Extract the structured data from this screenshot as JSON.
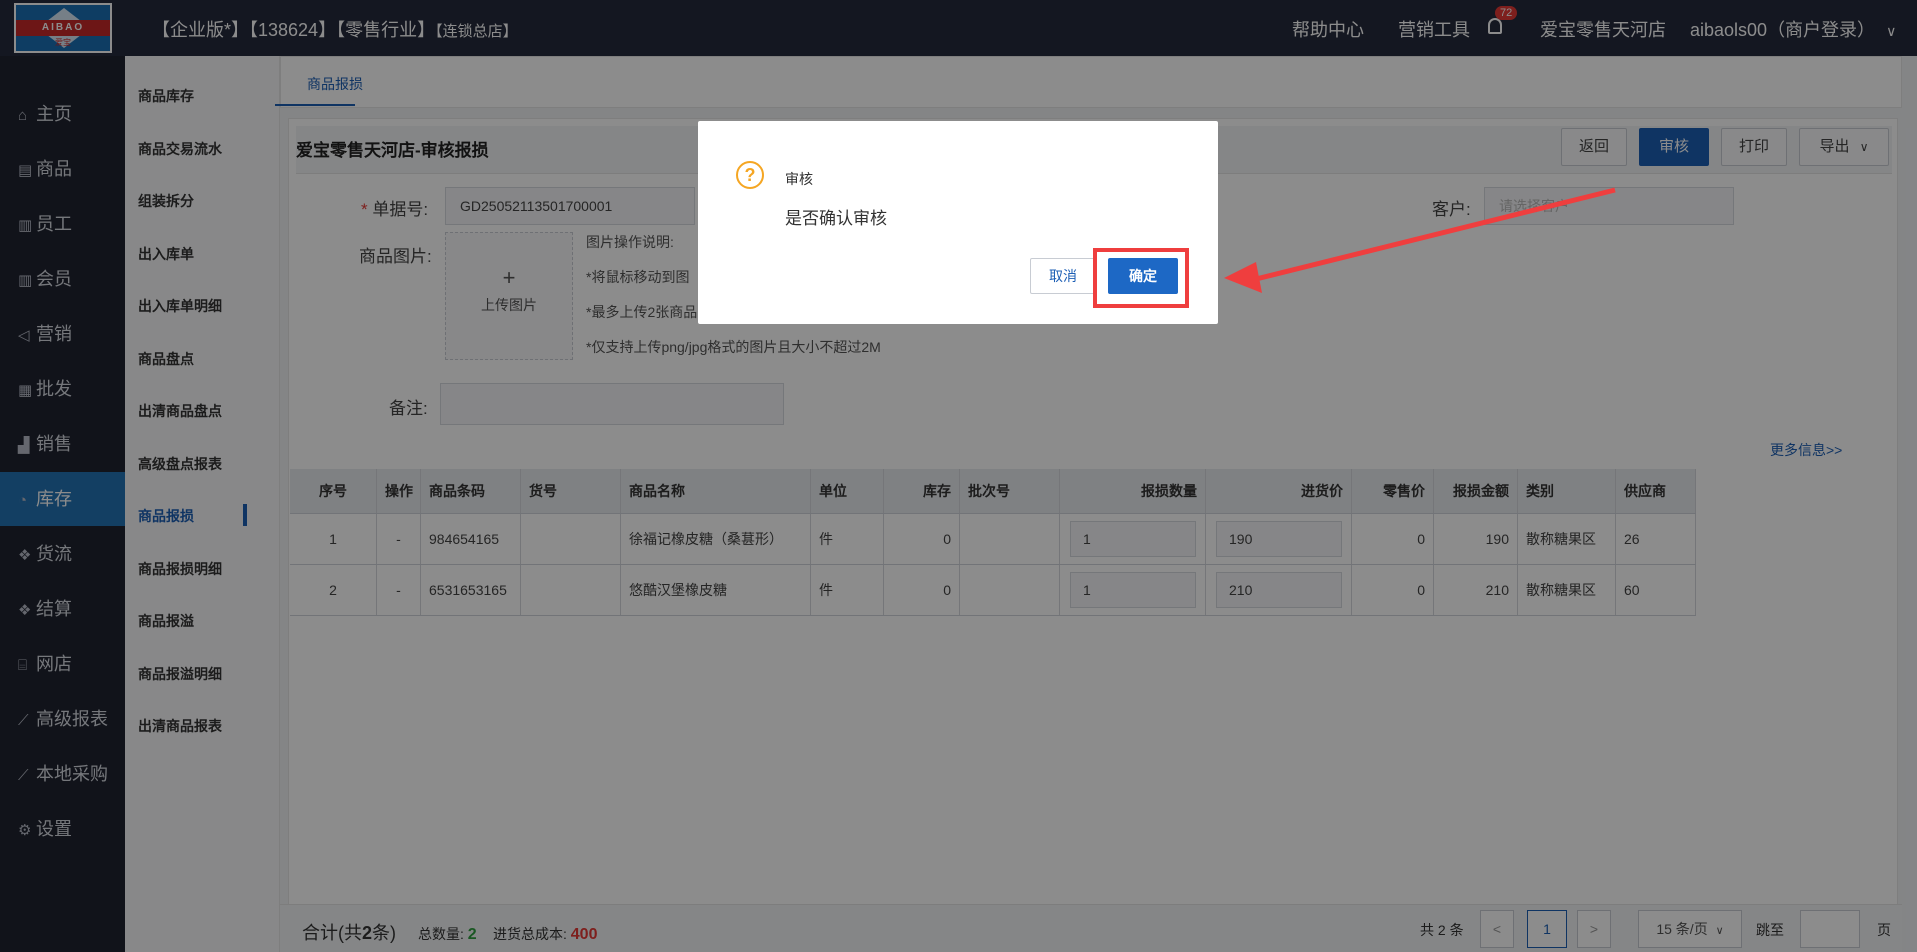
{
  "header": {
    "logo_text": "AIBAO",
    "logo_sub": "爱宝",
    "title_main": "【企业版*】【138624】【零售行业】",
    "title_small": "【连锁总店】",
    "help": "帮助中心",
    "marketing_tools": "营销工具",
    "notification_count": "72",
    "store_name": "爱宝零售天河店",
    "user": "aibaols00（商户登录）",
    "user_chevron": "∨"
  },
  "nav": {
    "items": [
      {
        "icon": "⌂",
        "label": "主页"
      },
      {
        "icon": "▤",
        "label": "商品"
      },
      {
        "icon": "▥",
        "label": "员工"
      },
      {
        "icon": "▥",
        "label": "会员"
      },
      {
        "icon": "◁",
        "label": "营销"
      },
      {
        "icon": "▦",
        "label": "批发"
      },
      {
        "icon": "▟",
        "label": "销售"
      },
      {
        "icon": "◔",
        "label": "库存"
      },
      {
        "icon": "❖",
        "label": "货流"
      },
      {
        "icon": "❖",
        "label": "结算"
      },
      {
        "icon": "⌸",
        "label": "网店"
      },
      {
        "icon": "⟋",
        "label": "高级报表"
      },
      {
        "icon": "⟋",
        "label": "本地采购"
      },
      {
        "icon": "⚙",
        "label": "设置"
      }
    ],
    "active_index": 7
  },
  "subnav": {
    "items": [
      "商品库存",
      "商品交易流水",
      "组装拆分",
      "出入库单",
      "出入库单明细",
      "商品盘点",
      "出清商品盘点",
      "高级盘点报表",
      "商品报损",
      "商品报损明细",
      "商品报溢",
      "商品报溢明细",
      "出清商品报表"
    ],
    "active_index": 8
  },
  "tab": {
    "label": "商品报损"
  },
  "panel": {
    "title": "爱宝零售天河店-审核报损",
    "buttons": {
      "back": "返回",
      "audit": "审核",
      "print": "打印",
      "export": "导出",
      "export_chevron": "∨"
    }
  },
  "form": {
    "order_no_label": "单据号:",
    "order_no_value": "GD25052113501700001",
    "customer_label": "客户:",
    "customer_placeholder": "请选择客户",
    "image_label": "商品图片:",
    "upload_plus": "+",
    "upload_text": "上传图片",
    "hints": [
      "图片操作说明:",
      "*将鼠标移动到图",
      "*最多上传2张商品",
      "*仅支持上传png/jpg格式的图片且大小不超过2M"
    ],
    "remark_label": "备注:",
    "more_info": "更多信息>>"
  },
  "table": {
    "columns": [
      "序号",
      "操作",
      "商品条码",
      "货号",
      "商品名称",
      "单位",
      "库存",
      "批次号",
      "报损数量",
      "进货价",
      "零售价",
      "报损金额",
      "类别",
      "供应商"
    ],
    "rows": [
      [
        "1",
        "-",
        "984654165",
        "",
        "徐福记橡皮糖（桑葚形）",
        "件",
        "0",
        "",
        "1",
        "190",
        "0",
        "190",
        "散称糖果区",
        "26"
      ],
      [
        "2",
        "-",
        "6531653165",
        "",
        "悠酷汉堡橡皮糖",
        "件",
        "0",
        "",
        "1",
        "210",
        "0",
        "210",
        "散称糖果区",
        "60"
      ]
    ]
  },
  "footer": {
    "total_label": "合计(共",
    "total_count": "2",
    "total_suffix": "条)",
    "qty_label": "总数量:",
    "qty_value": "2",
    "cost_label": "进货总成本:",
    "cost_value": "400",
    "pager_total": "共 2 条",
    "prev": "<",
    "page": "1",
    "next": ">",
    "page_size": "15 条/页",
    "jump_label": "跳至",
    "jump_suffix": "页"
  },
  "modal": {
    "icon": "?",
    "title": "审核",
    "message": "是否确认审核",
    "cancel": "取消",
    "confirm": "确定"
  },
  "colors": {
    "topbar": "#262b3d",
    "nav_bg": "#1f2330",
    "nav_active": "#2474b5",
    "primary": "#1d5fb5",
    "highlight_red": "#ef3e3e",
    "warn": "#f5a623"
  }
}
